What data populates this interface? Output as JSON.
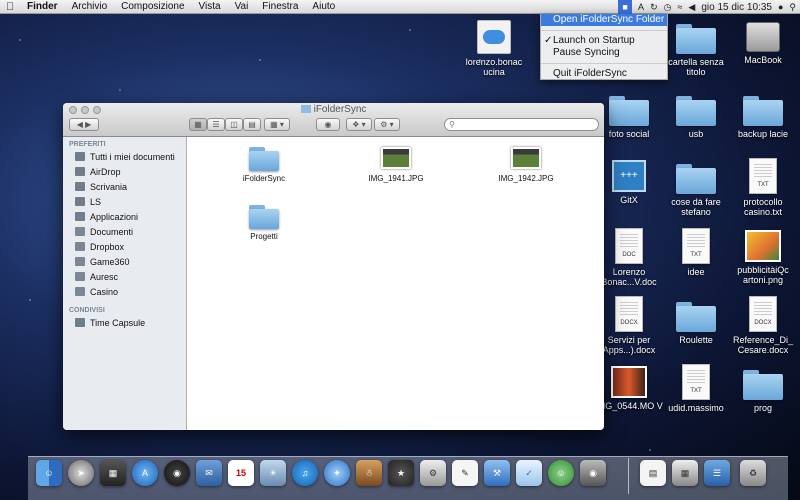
{
  "menubar": {
    "app_name": "Finder",
    "menus": [
      "Archivio",
      "Composizione",
      "Vista",
      "Vai",
      "Finestra",
      "Aiuto"
    ],
    "clock": "gio 15 dic  10:35"
  },
  "dropdown": {
    "items": [
      {
        "label": "Open iFolderSync Folder",
        "checked": false,
        "highlighted": true
      },
      {
        "label": "Launch on Startup",
        "checked": true,
        "highlighted": false
      },
      {
        "label": "Pause Syncing",
        "checked": false,
        "highlighted": false
      },
      {
        "label": "Quit iFolderSync",
        "checked": false,
        "highlighted": false
      }
    ]
  },
  "desktop": {
    "icons": [
      {
        "label": "lorenzo.bonac ucina",
        "kind": "cloud-doc"
      },
      {
        "label": "cartella senza titolo",
        "kind": "folder"
      },
      {
        "label": "MacBook",
        "kind": "drive"
      },
      {
        "label": "foto social",
        "kind": "folder"
      },
      {
        "label": "usb",
        "kind": "folder"
      },
      {
        "label": "backup lacie",
        "kind": "folder"
      },
      {
        "label": "GitX",
        "kind": "app"
      },
      {
        "label": "cose da fare stefano",
        "kind": "folder"
      },
      {
        "label": "protocollo casino.txt",
        "kind": "doc",
        "tag": "TXT"
      },
      {
        "label": "Lorenzo Bonac...V.doc",
        "kind": "doc",
        "tag": "DOC"
      },
      {
        "label": "idee",
        "kind": "doc",
        "tag": "TXT"
      },
      {
        "label": "pubblicitàiQc artoni.png",
        "kind": "image"
      },
      {
        "label": "Servizi per Apps...).docx",
        "kind": "doc",
        "tag": "DOCX"
      },
      {
        "label": "Roulette",
        "kind": "folder"
      },
      {
        "label": "Reference_Di_ Cesare.docx",
        "kind": "doc",
        "tag": "DOCX"
      },
      {
        "label": "IMG_0544.MO V",
        "kind": "image"
      },
      {
        "label": "udid.massimo",
        "kind": "doc",
        "tag": "TXT"
      },
      {
        "label": "prog",
        "kind": "folder"
      }
    ]
  },
  "finder": {
    "title": "iFolderSync",
    "search_placeholder": "",
    "sidebar": {
      "sections": [
        {
          "header": "PREFERITI",
          "items": [
            "Tutti i miei documenti",
            "AirDrop",
            "Scrivania",
            "LS",
            "Applicazioni",
            "Documenti",
            "Dropbox",
            "Game360",
            "Auresc",
            "Casino"
          ]
        },
        {
          "header": "CONDIVISI",
          "items": [
            "Time Capsule"
          ]
        }
      ]
    },
    "files": [
      {
        "name": "iFolderSync",
        "kind": "folder"
      },
      {
        "name": "IMG_1941.JPG",
        "kind": "image"
      },
      {
        "name": "IMG_1942.JPG",
        "kind": "image"
      },
      {
        "name": "Progetti",
        "kind": "folder"
      }
    ]
  },
  "dock": {
    "calendar_day": "15"
  }
}
